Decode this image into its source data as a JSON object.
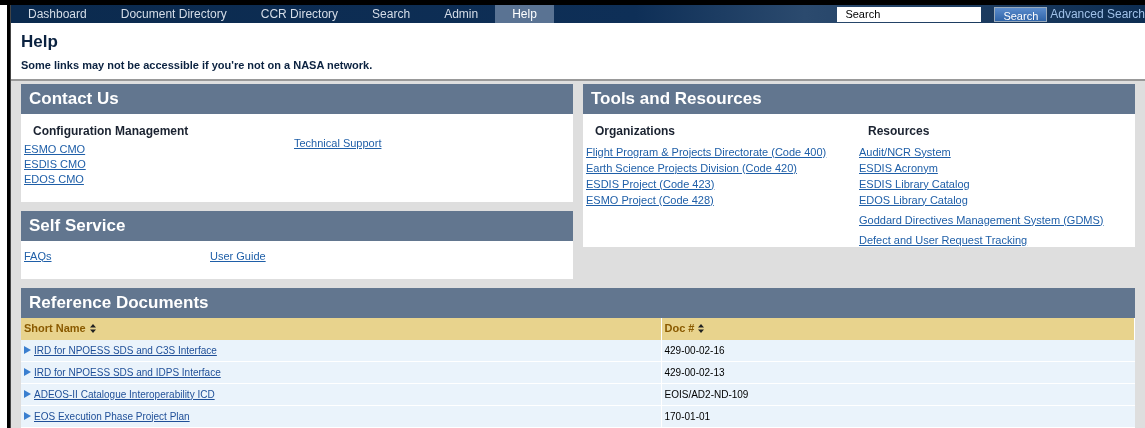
{
  "nav": {
    "tabs": [
      {
        "label": "Dashboard",
        "selected": false
      },
      {
        "label": "Document Directory",
        "selected": false
      },
      {
        "label": "CCR Directory",
        "selected": false
      },
      {
        "label": "Search",
        "selected": false
      },
      {
        "label": "Admin",
        "selected": false
      },
      {
        "label": "Help",
        "selected": true
      }
    ],
    "search": {
      "placeholder": "Search",
      "button": "Search",
      "advanced": "Advanced Search"
    }
  },
  "page": {
    "title": "Help",
    "notice": "Some links may not be accessible if you're not on a NASA network."
  },
  "contact_us": {
    "title": "Contact Us",
    "heading": "Configuration Management",
    "links": [
      "ESMO CMO",
      "ESDIS CMO",
      "EDOS CMO"
    ],
    "side_link": "Technical Support"
  },
  "self_service": {
    "title": "Self Service",
    "links": [
      "FAQs",
      "User Guide"
    ]
  },
  "tools": {
    "title": "Tools and Resources",
    "columns": [
      {
        "heading": "Organizations",
        "links": [
          "Flight Program & Projects Directorate (Code 400)",
          "Earth Science Projects Division (Code 420)",
          "ESDIS Project (Code 423)",
          "ESMO Project (Code 428)"
        ]
      },
      {
        "heading": "Resources",
        "links": [
          "Audit/NCR System",
          "ESDIS Acronym",
          "ESDIS Library Catalog",
          "EDOS Library Catalog",
          "Goddard Directives Management System (GDMS)",
          "Defect and User Request Tracking"
        ]
      }
    ]
  },
  "reference_documents": {
    "title": "Reference Documents",
    "columns": [
      "Short Name",
      "Doc #"
    ],
    "rows": [
      {
        "name": "IRD for NPOESS SDS and C3S Interface",
        "doc": "429-00-02-16"
      },
      {
        "name": "IRD for NPOESS SDS and IDPS Interface",
        "doc": "429-00-02-13"
      },
      {
        "name": "ADEOS-II Catalogue Interoperability ICD",
        "doc": "EOIS/AD2-ND-109"
      },
      {
        "name": "EOS Execution Phase Project Plan",
        "doc": "170-01-01"
      }
    ]
  }
}
